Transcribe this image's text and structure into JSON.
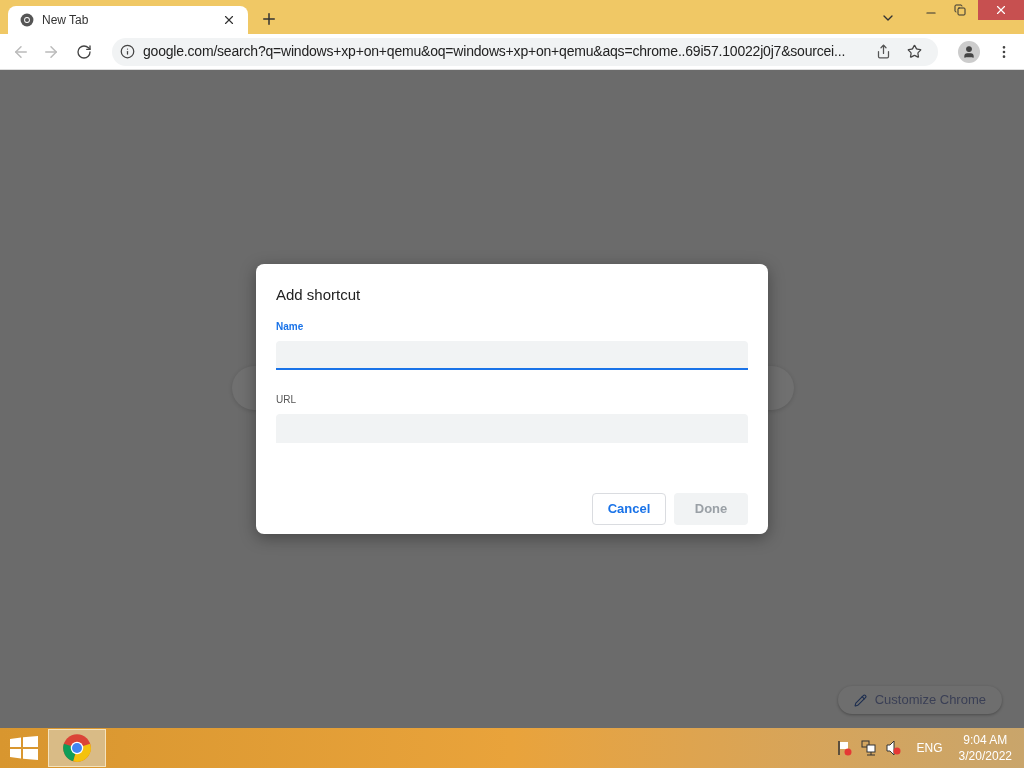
{
  "browser": {
    "tabs": [
      {
        "title": "New Tab",
        "selected": true
      }
    ],
    "url": "google.com/search?q=windows+xp+on+qemu&oq=windows+xp+on+qemu&aqs=chrome..69i57.10022j0j7&sourcei..."
  },
  "dialog": {
    "title": "Add shortcut",
    "fields": [
      {
        "label": "Name",
        "focused": true
      },
      {
        "label": "URL",
        "focused": false
      }
    ],
    "buttons": [
      {
        "label": "Cancel",
        "disabled": false
      },
      {
        "label": "Done",
        "disabled": true
      }
    ]
  },
  "customize": {
    "label": "Customize Chrome"
  },
  "taskbar": {
    "apps": [
      {
        "kind": "chrome",
        "selected": true
      }
    ],
    "language": "ENG",
    "time": "9:04 AM",
    "date": "3/20/2022"
  }
}
